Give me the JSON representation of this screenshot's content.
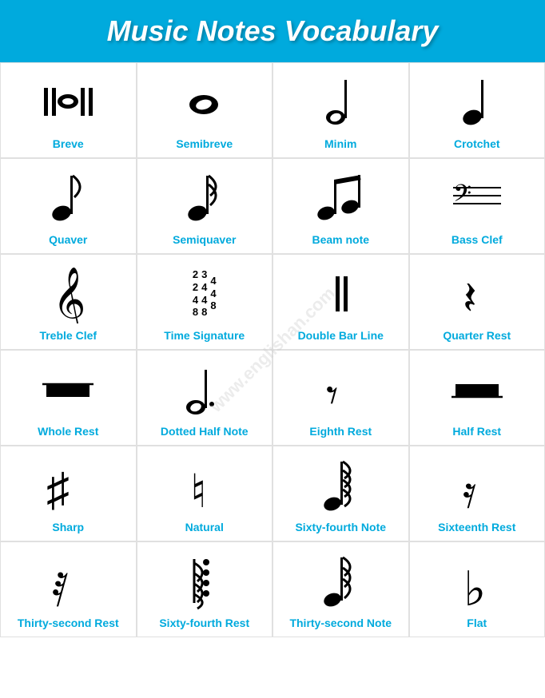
{
  "header": {
    "title": "Music Notes Vocabulary"
  },
  "items": [
    {
      "name": "breve",
      "label": "Breve",
      "symbol": "breve"
    },
    {
      "name": "semibreve",
      "label": "Semibreve",
      "symbol": "semibreve"
    },
    {
      "name": "minim",
      "label": "Minim",
      "symbol": "minim"
    },
    {
      "name": "crotchet",
      "label": "Crotchet",
      "symbol": "crotchet"
    },
    {
      "name": "quaver",
      "label": "Quaver",
      "symbol": "quaver"
    },
    {
      "name": "semiquaver",
      "label": "Semiquaver",
      "symbol": "semiquaver"
    },
    {
      "name": "beam-note",
      "label": "Beam note",
      "symbol": "beam"
    },
    {
      "name": "bass-clef",
      "label": "Bass Clef",
      "symbol": "bass"
    },
    {
      "name": "treble-clef",
      "label": "Treble Clef",
      "symbol": "treble"
    },
    {
      "name": "time-signature",
      "label": "Time Signature",
      "symbol": "timesig"
    },
    {
      "name": "double-bar-line",
      "label": "Double Bar Line",
      "symbol": "doublebar"
    },
    {
      "name": "quarter-rest",
      "label": "Quarter Rest",
      "symbol": "quarterrest"
    },
    {
      "name": "whole-rest",
      "label": "Whole Rest",
      "symbol": "wholerest"
    },
    {
      "name": "dotted-half-note",
      "label": "Dotted Half Note",
      "symbol": "dottedhalfnote"
    },
    {
      "name": "eighth-rest",
      "label": "Eighth Rest",
      "symbol": "eighthrest"
    },
    {
      "name": "half-rest",
      "label": "Half Rest",
      "symbol": "halfrest"
    },
    {
      "name": "sharp",
      "label": "Sharp",
      "symbol": "sharp"
    },
    {
      "name": "natural",
      "label": "Natural",
      "symbol": "natural"
    },
    {
      "name": "sixty-fourth-note",
      "label": "Sixty-fourth Note",
      "symbol": "sixtyfourth"
    },
    {
      "name": "sixteenth-rest",
      "label": "Sixteenth Rest",
      "symbol": "sixteenthrest"
    },
    {
      "name": "thirty-second-rest",
      "label": "Thirty-second Rest",
      "symbol": "thirtysecondrest"
    },
    {
      "name": "sixty-fourth-rest",
      "label": "Sixty-fourth Rest",
      "symbol": "sixtyfourthrest"
    },
    {
      "name": "thirty-second-note",
      "label": "Thirty-second Note",
      "symbol": "thirtysecondnote"
    },
    {
      "name": "flat",
      "label": "Flat",
      "symbol": "flat"
    }
  ]
}
